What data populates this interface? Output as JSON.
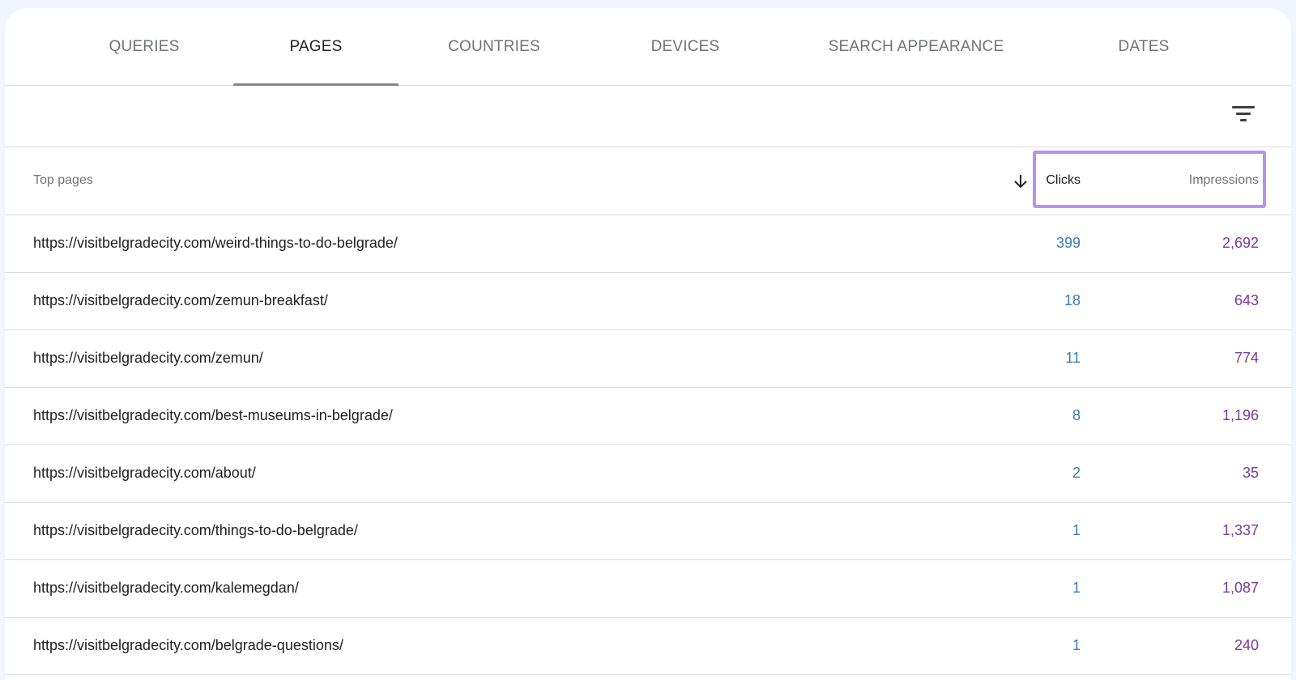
{
  "tabs": [
    {
      "label": "QUERIES",
      "active": false
    },
    {
      "label": "PAGES",
      "active": true
    },
    {
      "label": "COUNTRIES",
      "active": false
    },
    {
      "label": "DEVICES",
      "active": false
    },
    {
      "label": "SEARCH APPEARANCE",
      "active": false
    },
    {
      "label": "DATES",
      "active": false
    }
  ],
  "toolbar": {
    "filter_icon": "filter-icon"
  },
  "table": {
    "header": {
      "label": "Top pages",
      "sort_icon": "arrow-down-icon",
      "clicks": "Clicks",
      "impressions": "Impressions"
    },
    "rows": [
      {
        "url": "https://visitbelgradecity.com/weird-things-to-do-belgrade/",
        "clicks": "399",
        "impressions": "2,692"
      },
      {
        "url": "https://visitbelgradecity.com/zemun-breakfast/",
        "clicks": "18",
        "impressions": "643"
      },
      {
        "url": "https://visitbelgradecity.com/zemun/",
        "clicks": "11",
        "impressions": "774"
      },
      {
        "url": "https://visitbelgradecity.com/best-museums-in-belgrade/",
        "clicks": "8",
        "impressions": "1,196"
      },
      {
        "url": "https://visitbelgradecity.com/about/",
        "clicks": "2",
        "impressions": "35"
      },
      {
        "url": "https://visitbelgradecity.com/things-to-do-belgrade/",
        "clicks": "1",
        "impressions": "1,337"
      },
      {
        "url": "https://visitbelgradecity.com/kalemegdan/",
        "clicks": "1",
        "impressions": "1,087"
      },
      {
        "url": "https://visitbelgradecity.com/belgrade-questions/",
        "clicks": "1",
        "impressions": "240"
      }
    ]
  },
  "colors": {
    "clicks": "#3b7cb8",
    "impressions": "#7a3b9a",
    "highlight": "#b694ee",
    "active_tab_underline": "#80868b"
  }
}
